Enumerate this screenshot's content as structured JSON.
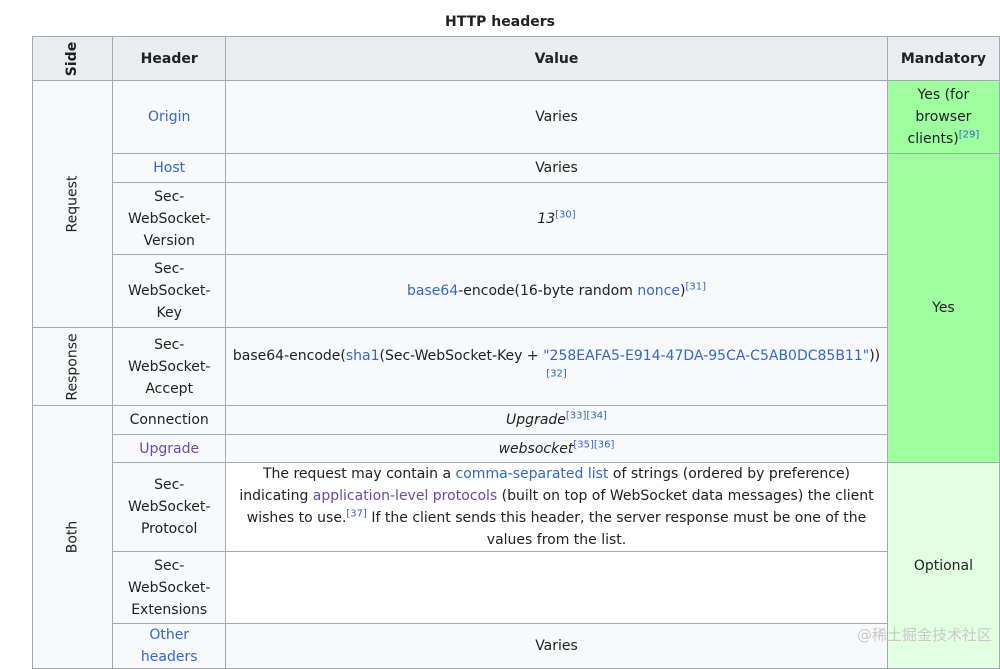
{
  "caption": "HTTP headers",
  "columns": {
    "side": "Side",
    "header": "Header",
    "value": "Value",
    "mandatory": "Mandatory"
  },
  "groups": {
    "request": "Request",
    "response": "Response",
    "both": "Both"
  },
  "rows": [
    {
      "header": "Origin",
      "value": "Varies",
      "mandatory": "Yes (for browser clients)",
      "mandatory_ref": "[29]"
    },
    {
      "header": "Host",
      "value": "Varies"
    },
    {
      "header": "Sec-WebSocket-Version",
      "value": "13",
      "ref": "[30]"
    },
    {
      "header": "Sec-WebSocket-Key",
      "value_parts": {
        "a": "base64",
        "b": "-encode(16-byte random ",
        "c": "nonce",
        "d": ")"
      },
      "ref": "[31]"
    },
    {
      "header": "Sec-WebSocket-Accept",
      "value_parts": {
        "a": "base64-encode(",
        "b": "sha1",
        "c": "(Sec-WebSocket-Key + ",
        "d": "\"258EAFA5-E914-47DA-95CA-C5AB0DC85B11\"",
        "e": "))"
      },
      "ref": "[32]"
    },
    {
      "header": "Connection",
      "value": "Upgrade",
      "ref": "[33][34]"
    },
    {
      "header": "Upgrade",
      "value": "websocket",
      "ref": "[35][36]"
    },
    {
      "header": "Sec-WebSocket-Protocol",
      "value_parts": {
        "a": "The request may contain a ",
        "b": "comma-separated list",
        "c": " of strings (ordered by preference) indicating ",
        "d": "application-level protocols",
        "e": " (built on top of WebSocket data messages) the client wishes to use.",
        "f": " If the client sends this header, the server response must be one of the values from the list."
      },
      "ref": "[37]"
    },
    {
      "header": "Sec-WebSocket-Extensions",
      "value": ""
    },
    {
      "header": "Other headers",
      "value": "Varies"
    }
  ],
  "mandatory": {
    "yes": "Yes",
    "optional": "Optional"
  },
  "watermark": "@稀土掘金技术社区",
  "colors": {
    "yes": "#9eff9e",
    "optional": "#e1ffe1",
    "link": "#3366cc",
    "visited": "#6b4ba1",
    "header_bg": "#eaecf0"
  }
}
